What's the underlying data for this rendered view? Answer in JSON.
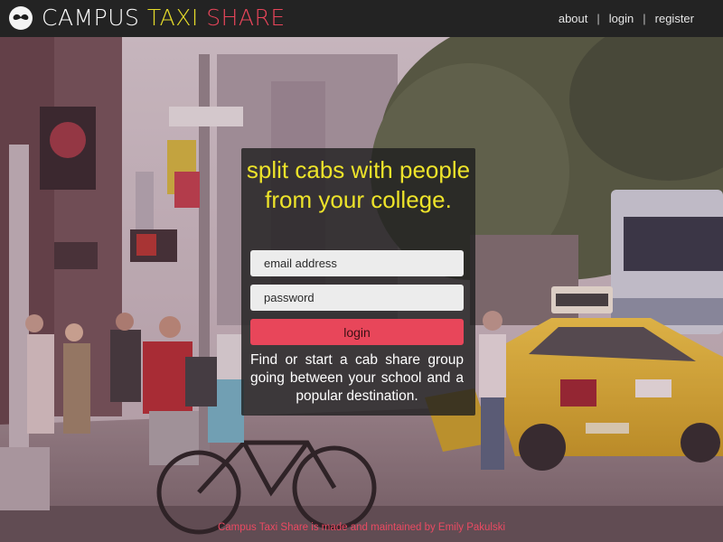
{
  "header": {
    "logo_icon": "mustache-logo-icon",
    "brand": {
      "word1": "CAMPUS",
      "word2": "TAXI",
      "word3": "SHARE"
    },
    "nav": {
      "about": "about",
      "login": "login",
      "register": "register",
      "separator": "|"
    }
  },
  "hero": {
    "headline": "split cabs with people from your college.",
    "email_placeholder": "email address",
    "password_placeholder": "password",
    "login_label": "login",
    "description": "Find or start a cab share group going between your school and a popular destination."
  },
  "footer": {
    "credit": "Campus Taxi Share is made and maintained by Emily Pakulski"
  },
  "colors": {
    "header_bg": "#232323",
    "taxi_yellow": "#e6dc2a",
    "share_red": "#e8455a",
    "button_red": "#e8465a",
    "headline_yellow": "#ede32a"
  }
}
